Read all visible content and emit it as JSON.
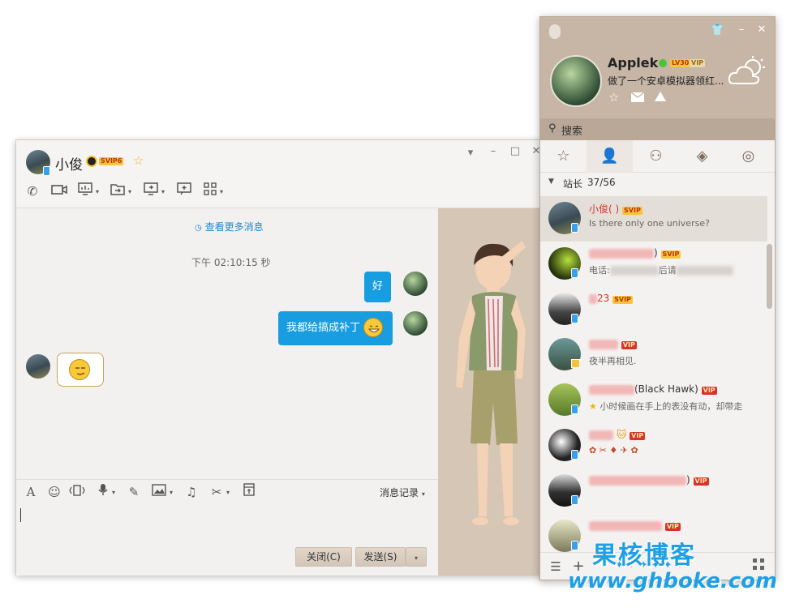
{
  "chat": {
    "contact_name": "小俊",
    "vip_badge": "SVIP6",
    "more_messages": "查看更多消息",
    "timestamp": "下午 02:10:15 秒",
    "messages": [
      {
        "from": "me",
        "text": "好"
      },
      {
        "from": "me",
        "text": "我都给搞成补丁"
      }
    ],
    "history_label": "消息记录",
    "close_label": "关闭(C)",
    "send_label": "发送(S)"
  },
  "main": {
    "username": "Applek",
    "level_badge": "LV30",
    "vip_badge": "VIP",
    "signature": "做了一个安卓模拟器领红...",
    "search_placeholder": "搜索",
    "group_label": "站长",
    "group_count": "37/56",
    "contacts": [
      {
        "name": "小俊( )",
        "badge": "SVIP",
        "sub": "Is there only one universe?"
      },
      {
        "name": ")",
        "badge": "SVIP",
        "sub_prefix": "电话:",
        "sub": "后请"
      },
      {
        "name": "23",
        "badge": "SVIP",
        "sub": ""
      },
      {
        "name": "",
        "badge": "VIP",
        "sub": "夜半再相见."
      },
      {
        "name": "(Black Hawk)",
        "badge": "VIP",
        "sub": "小时候画在手上的表没有动，却带走"
      },
      {
        "name": "",
        "badge": "VIP",
        "sub": ""
      },
      {
        "name": ")",
        "badge": "VIP",
        "sub": ""
      },
      {
        "name": "",
        "badge": "VIP",
        "sub": ""
      }
    ]
  },
  "watermark": {
    "line1": "果核博客",
    "line2": "www.ghboke.com"
  },
  "colors": {
    "accent_blue": "#189ee0",
    "panel_brown": "#c7b6a5",
    "vip_red": "#d8322b",
    "svip_gold": "#f6c33b"
  }
}
